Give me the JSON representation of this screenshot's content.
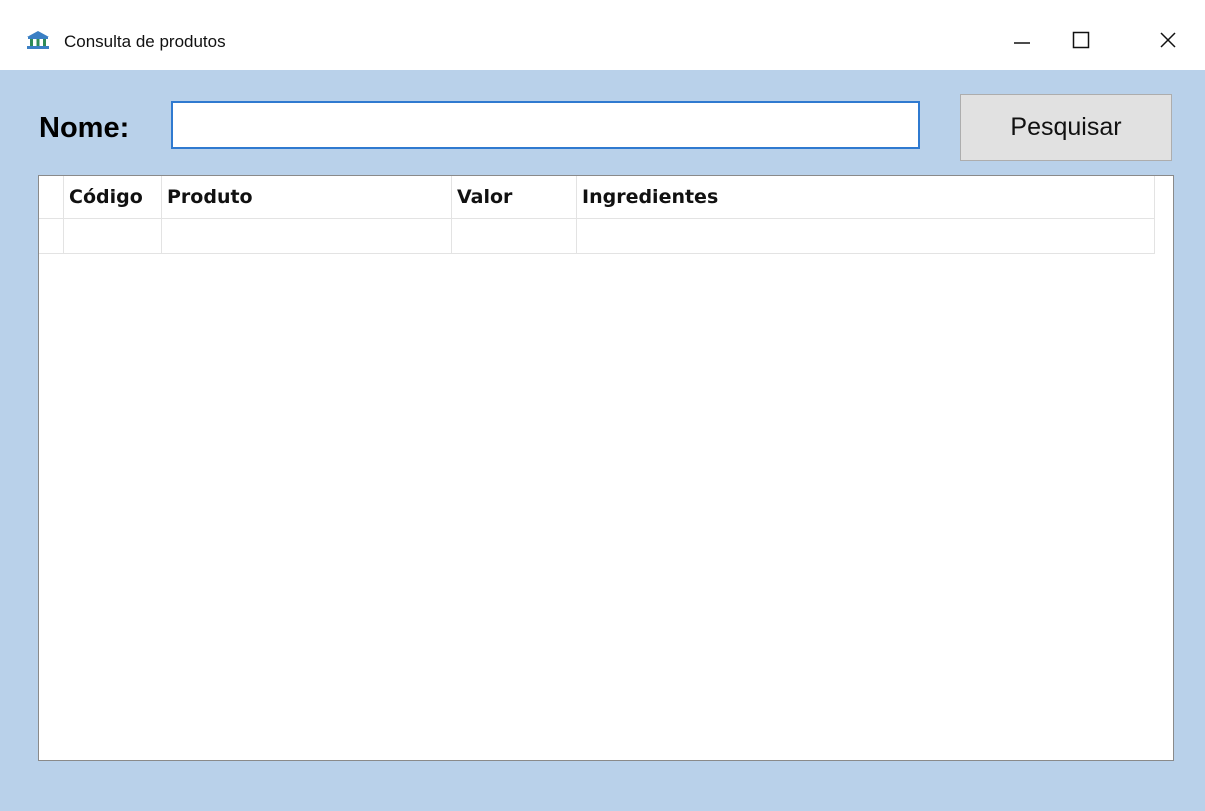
{
  "window": {
    "title": "Consulta de produtos",
    "icon": "bank-icon",
    "controls": [
      "minimize-icon",
      "maximize-icon",
      "close-icon"
    ]
  },
  "search": {
    "label": "Nome:",
    "value": "",
    "button_label": "Pesquisar"
  },
  "grid": {
    "columns": [
      "Código",
      "Produto",
      "Valor",
      "Ingredientes"
    ],
    "rows": [
      [
        "",
        "",
        "",
        ""
      ]
    ]
  },
  "colors": {
    "client_background": "#b9d1ea",
    "input_focus_border": "#2f7ad0",
    "button_face": "#e1e1e1"
  }
}
